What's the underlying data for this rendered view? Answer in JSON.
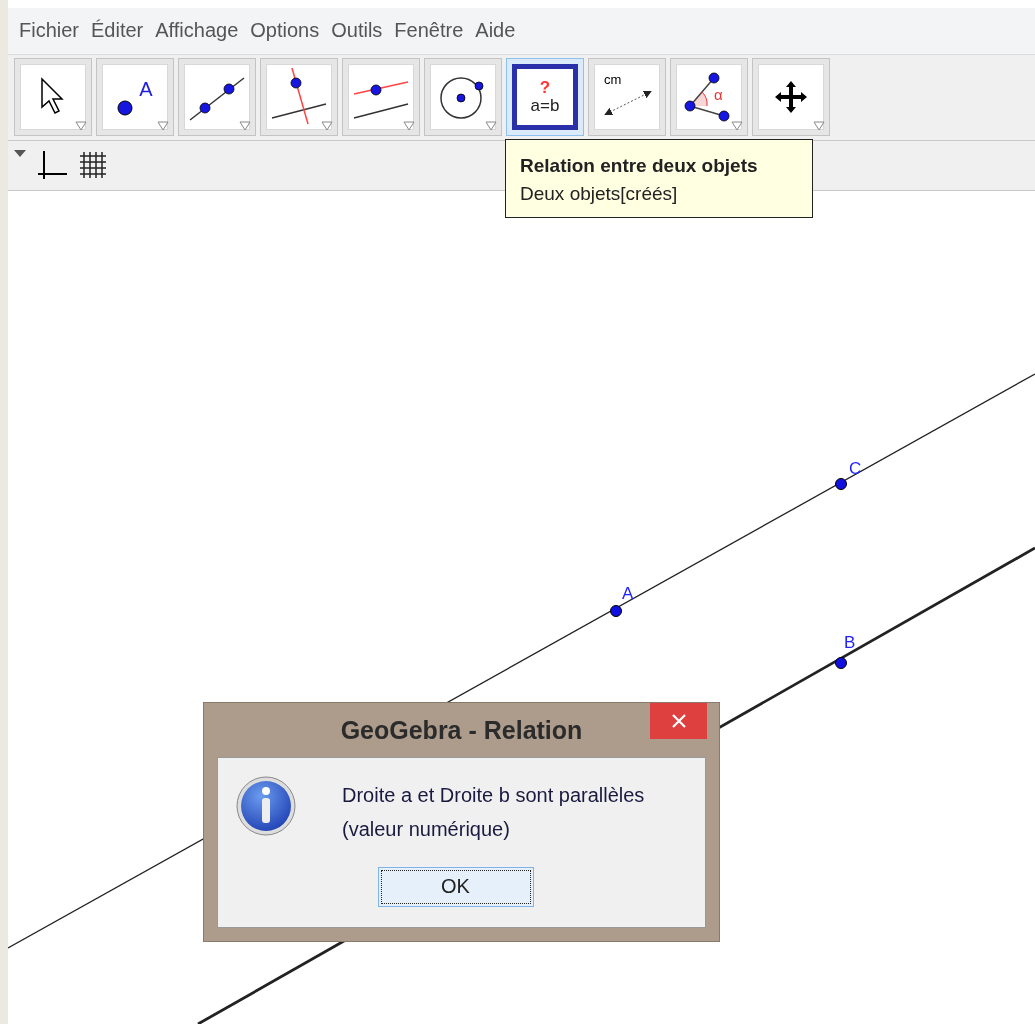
{
  "menu": [
    {
      "label": "Fichier"
    },
    {
      "label": "Éditer"
    },
    {
      "label": "Affichage"
    },
    {
      "label": "Options"
    },
    {
      "label": "Outils"
    },
    {
      "label": "Fenêtre"
    },
    {
      "label": "Aide"
    }
  ],
  "toolbar": [
    {
      "kind": "move",
      "selected": false,
      "has_menu": true
    },
    {
      "kind": "point",
      "text": "A",
      "selected": false,
      "has_menu": true
    },
    {
      "kind": "line",
      "selected": false,
      "has_menu": true
    },
    {
      "kind": "perpendicular",
      "selected": false,
      "has_menu": true
    },
    {
      "kind": "parallel",
      "selected": false,
      "has_menu": true
    },
    {
      "kind": "circle",
      "selected": false,
      "has_menu": true
    },
    {
      "kind": "relation",
      "text": "?",
      "text2": "a=b",
      "selected": true,
      "has_menu": false
    },
    {
      "kind": "distance",
      "text": "cm",
      "selected": false,
      "has_menu": false
    },
    {
      "kind": "angle",
      "text": "α",
      "selected": false,
      "has_menu": true
    },
    {
      "kind": "pan",
      "selected": false,
      "has_menu": true
    }
  ],
  "tooltip": {
    "title": "Relation entre deux objets",
    "subtitle": "Deux objets[créés]"
  },
  "canvas": {
    "points": [
      {
        "label": "C"
      },
      {
        "label": "A"
      },
      {
        "label": "B"
      }
    ]
  },
  "dialog": {
    "title": "GeoGebra - Relation",
    "message": [
      "Droite a et Droite b sont parallèles",
      "(valeur numérique)"
    ],
    "button": "OK"
  }
}
